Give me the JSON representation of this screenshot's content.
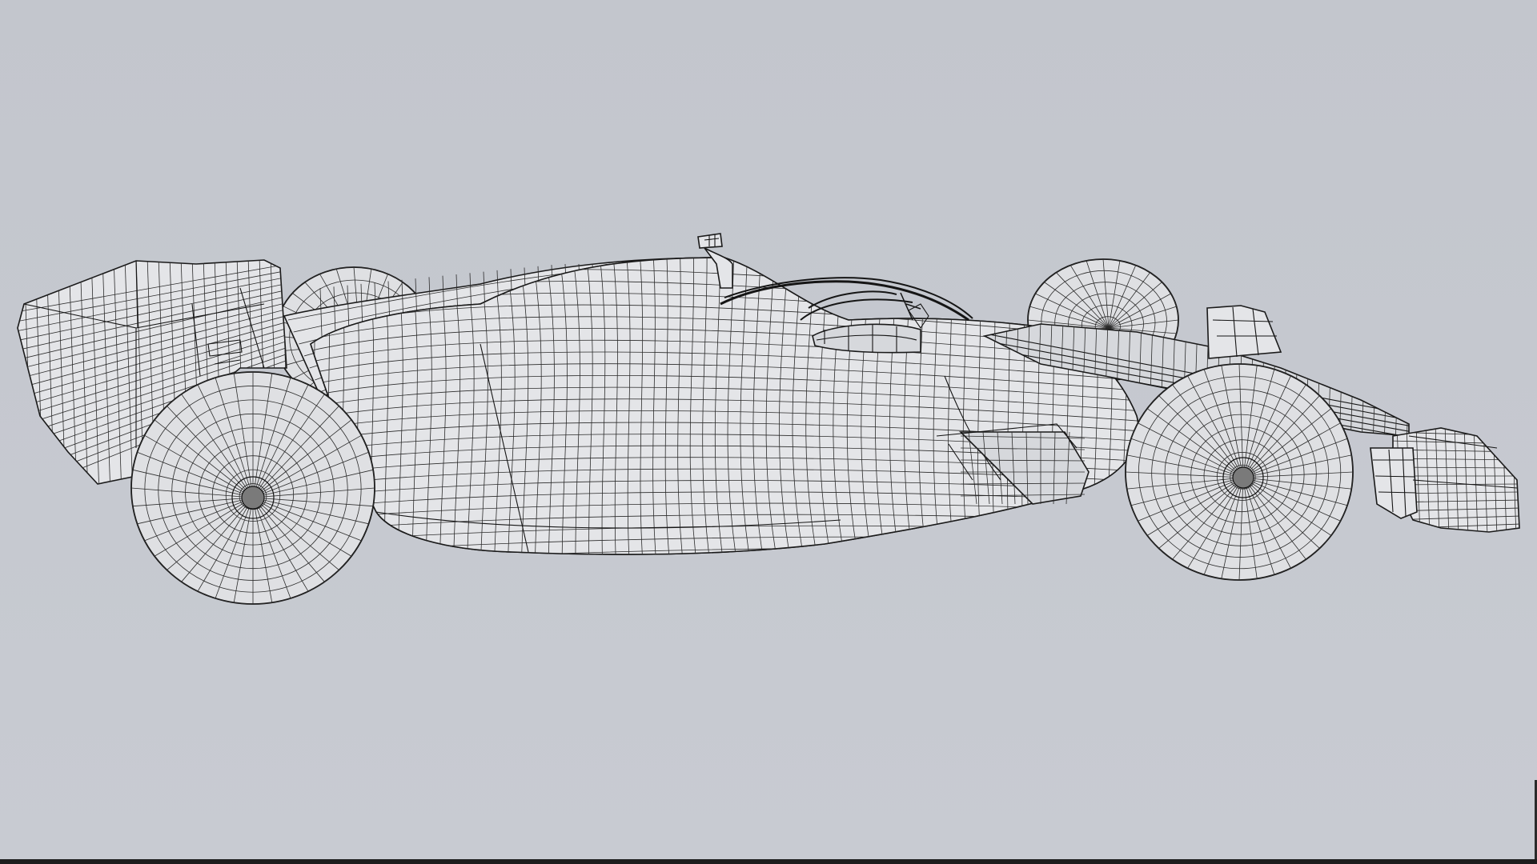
{
  "viewer": {
    "background_color": "#c6c9d0",
    "wire_color": "#1a1a1a",
    "surface_color": "#e4e5e8",
    "model_parts": [
      "rear-wing",
      "rear-wheel-far",
      "rear-wheel-near",
      "engine-cover",
      "sidepod",
      "floor",
      "halo",
      "cockpit",
      "camera-pod",
      "nose",
      "front-wheel-far",
      "front-wheel-near",
      "front-wing"
    ]
  }
}
